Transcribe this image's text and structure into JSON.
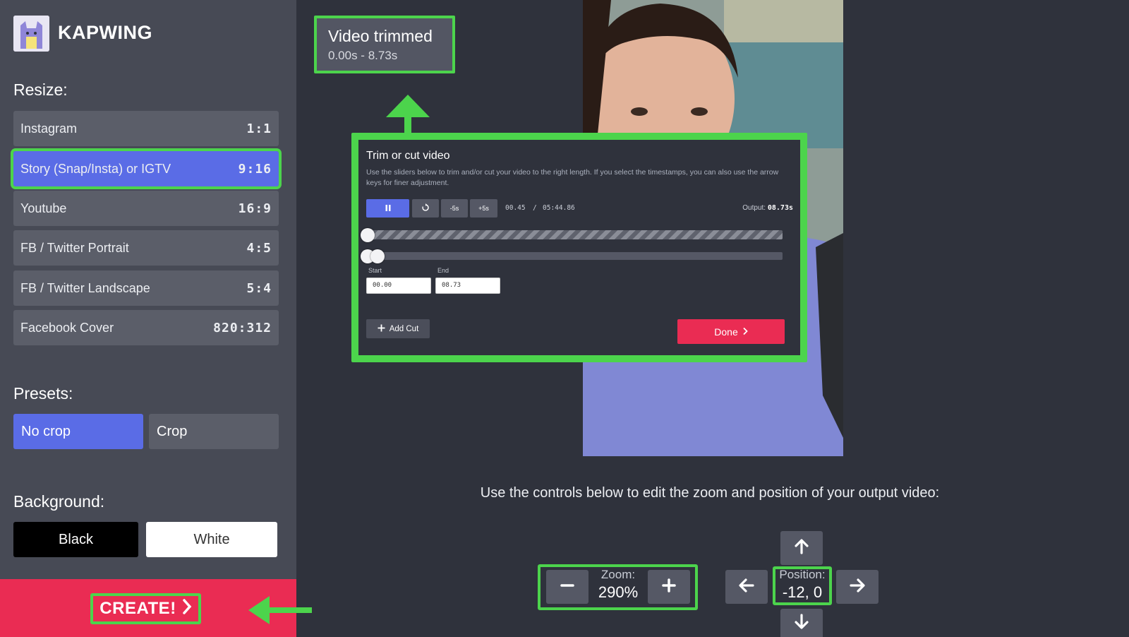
{
  "brand": {
    "name": "KAPWING"
  },
  "resize": {
    "title": "Resize:",
    "items": [
      {
        "label": "Instagram",
        "ratio": "1:1"
      },
      {
        "label": "Story (Snap/Insta) or IGTV",
        "ratio": "9:16",
        "selected": true
      },
      {
        "label": "Youtube",
        "ratio": "16:9"
      },
      {
        "label": "FB / Twitter Portrait",
        "ratio": "4:5"
      },
      {
        "label": "FB / Twitter Landscape",
        "ratio": "5:4"
      },
      {
        "label": "Facebook Cover",
        "ratio": "820:312"
      }
    ]
  },
  "presets": {
    "title": "Presets:",
    "options": [
      {
        "label": "No crop",
        "selected": true
      },
      {
        "label": "Crop",
        "selected": false
      }
    ]
  },
  "background": {
    "title": "Background:",
    "options": [
      {
        "label": "Black",
        "color": "#000000"
      },
      {
        "label": "White",
        "color": "#ffffff"
      }
    ]
  },
  "create": {
    "label": "CREATE!"
  },
  "tooltip": {
    "title": "Video trimmed",
    "range": "0.00s - 8.73s"
  },
  "trim": {
    "title": "Trim or cut video",
    "description": "Use the sliders below to trim and/or cut your video to the right length. If you select the timestamps, you can also use the arrow keys for finer adjustment.",
    "controls": {
      "pause_icon": "pause-icon",
      "restart_icon": "restart-icon",
      "minus5": "-5s",
      "plus5": "+5s"
    },
    "current_time": "00.45",
    "separator": "/",
    "total_time": "05:44.86",
    "output_label": "Output:",
    "output_value": "08.73s",
    "start_label": "Start",
    "start_value": "00.00",
    "end_label": "End",
    "end_value": "08.73",
    "add_cut_label": "Add Cut",
    "done_label": "Done"
  },
  "instruction": "Use the controls below to edit the zoom and position of your output video:",
  "zoom": {
    "label": "Zoom:",
    "value": "290%"
  },
  "position": {
    "label": "Position:",
    "value": "-12, 0"
  },
  "colors": {
    "accent": "#5a6ce6",
    "create": "#ea2c53",
    "highlight": "#4cd44c",
    "sidebar": "#474a55",
    "background": "#2f323c"
  }
}
